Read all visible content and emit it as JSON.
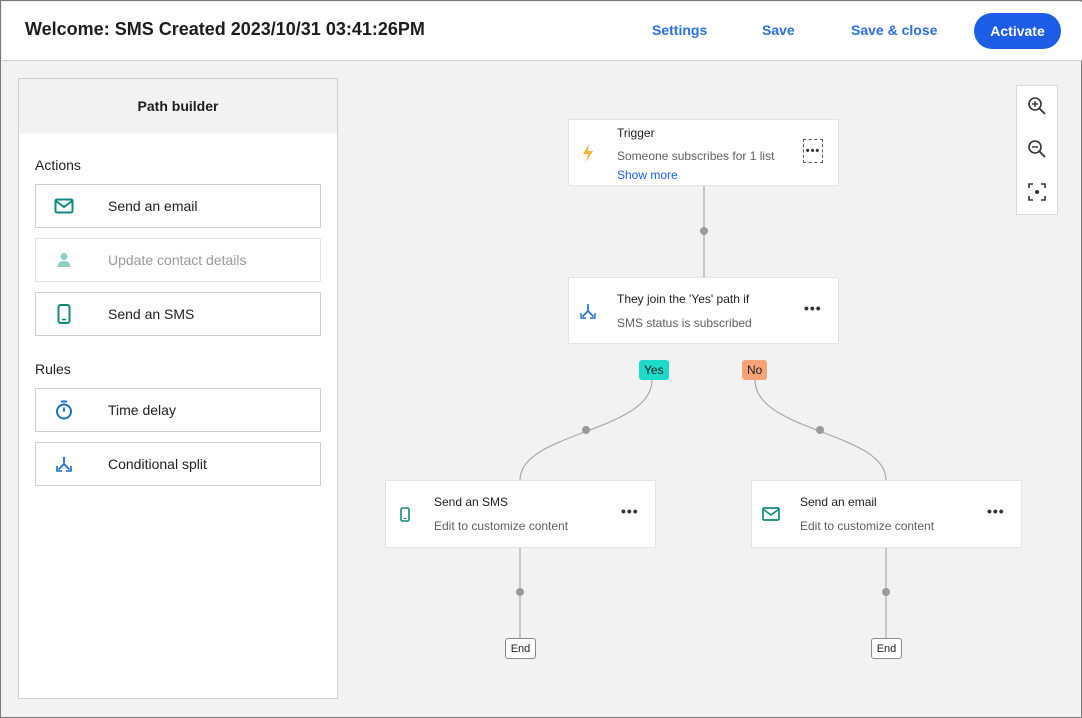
{
  "header": {
    "title": "Welcome: SMS Created 2023/10/31 03:41:26PM",
    "settings_label": "Settings",
    "save_label": "Save",
    "save_close_label": "Save & close",
    "activate_label": "Activate"
  },
  "sidebar": {
    "heading": "Path builder",
    "actions_label": "Actions",
    "actions": [
      {
        "label": "Send an email",
        "icon": "envelope-icon"
      },
      {
        "label": "Update contact details",
        "icon": "person-icon",
        "disabled": true
      },
      {
        "label": "Send an SMS",
        "icon": "phone-icon"
      }
    ],
    "rules_label": "Rules",
    "rules": [
      {
        "label": "Time delay",
        "icon": "stopwatch-icon"
      },
      {
        "label": "Conditional split",
        "icon": "split-icon"
      }
    ]
  },
  "flow": {
    "trigger": {
      "title": "Trigger",
      "subtitle": "Someone subscribes for 1 list",
      "show_more": "Show more",
      "icon": "lightning-icon"
    },
    "split": {
      "title": "They join the 'Yes' path if",
      "subtitle": "SMS status is subscribed",
      "icon": "split-icon"
    },
    "yes_label": "Yes",
    "no_label": "No",
    "sms_node": {
      "title": "Send an SMS",
      "subtitle": "Edit to customize content",
      "icon": "phone-icon"
    },
    "email_node": {
      "title": "Send an email",
      "subtitle": "Edit to customize content",
      "icon": "envelope-icon"
    },
    "end_label": "End",
    "more_label": "•••"
  },
  "colors": {
    "accent": "#1d5ce5",
    "teal_icon": "#128a7b",
    "yes_badge": "#1ddbc9",
    "no_badge": "#f7a37a",
    "trigger_icon": "#f5b53d"
  }
}
